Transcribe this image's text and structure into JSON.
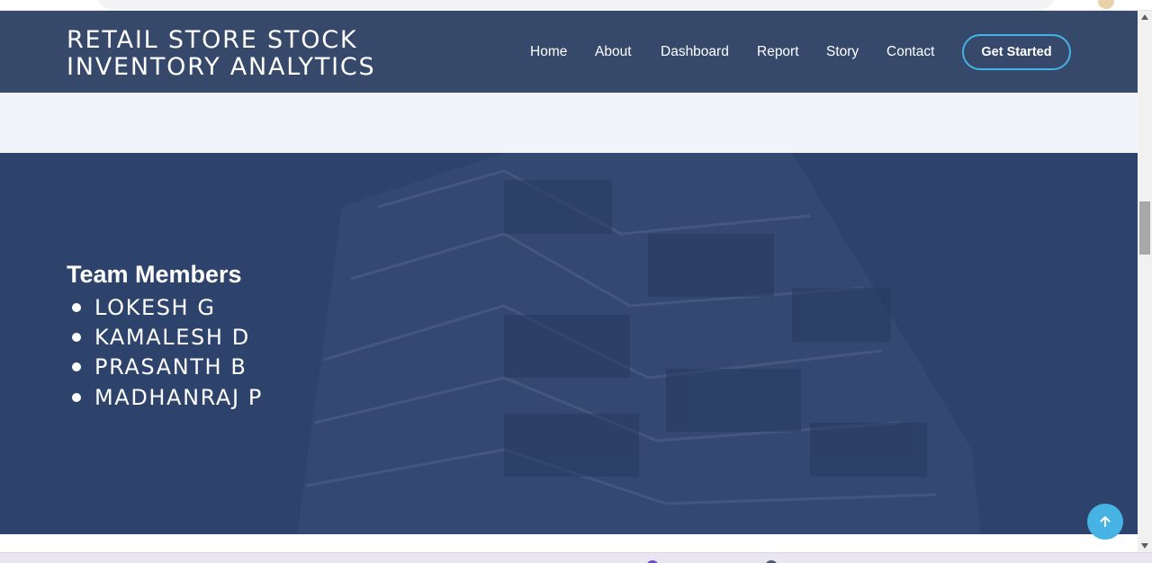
{
  "header": {
    "logo_line1": "RETAIL STORE STOCK",
    "logo_line2": "INVENTORY ANALYTICS",
    "nav": {
      "home": "Home",
      "about": "About",
      "dashboard": "Dashboard",
      "report": "Report",
      "story": "Story",
      "contact": "Contact"
    },
    "cta": "Get Started"
  },
  "team": {
    "title": "Team Members",
    "members": [
      "LOKESH G",
      "KAMALESH D",
      "PRASANTH B",
      "MADHANRAJ P"
    ]
  },
  "icons": {
    "back_to_top": "arrow-up-icon",
    "scroll_up": "triangle-up-icon",
    "scroll_down": "triangle-down-icon"
  },
  "colors": {
    "header_bg": "#37496b",
    "hero_bg": "#2e436b",
    "accent": "#47b2e4",
    "section_light": "#f2f4fb"
  }
}
